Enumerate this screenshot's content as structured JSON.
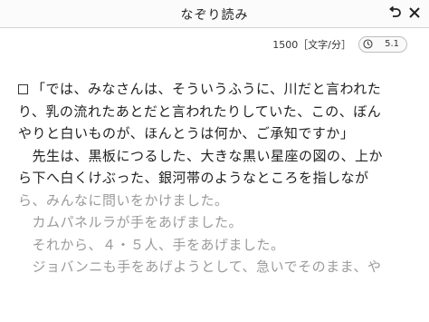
{
  "header": {
    "title": "なぞり読み"
  },
  "toolbar": {
    "speed_label": "1500［文字/分］",
    "speed_value": "5.1"
  },
  "text_lines": [
    {
      "text": "「では、みなさんは、そういうふうに、川だと言われた",
      "dim": false,
      "checkbox": true
    },
    {
      "text": "り、乳の流れたあとだと言われたりしていた、この、ぼん",
      "dim": false
    },
    {
      "text": "やりと白いものが、ほんとうは何か、ご承知ですか」",
      "dim": false
    },
    {
      "text": "　先生は、黒板につるした、大きな黒い星座の図の、上か",
      "dim": false
    },
    {
      "text": "ら下へ白くけぶった、銀河帯のようなところを指しなが",
      "dim": false
    },
    {
      "text": "ら、みんなに問いをかけました。",
      "dim": true
    },
    {
      "text": "　カムパネルラが手をあげました。",
      "dim": true
    },
    {
      "text": "　それから、４・５人、手をあげました。",
      "dim": true
    },
    {
      "text": "　ジョバンニも手をあげようとして、急いでそのまま、や",
      "dim": true
    }
  ]
}
